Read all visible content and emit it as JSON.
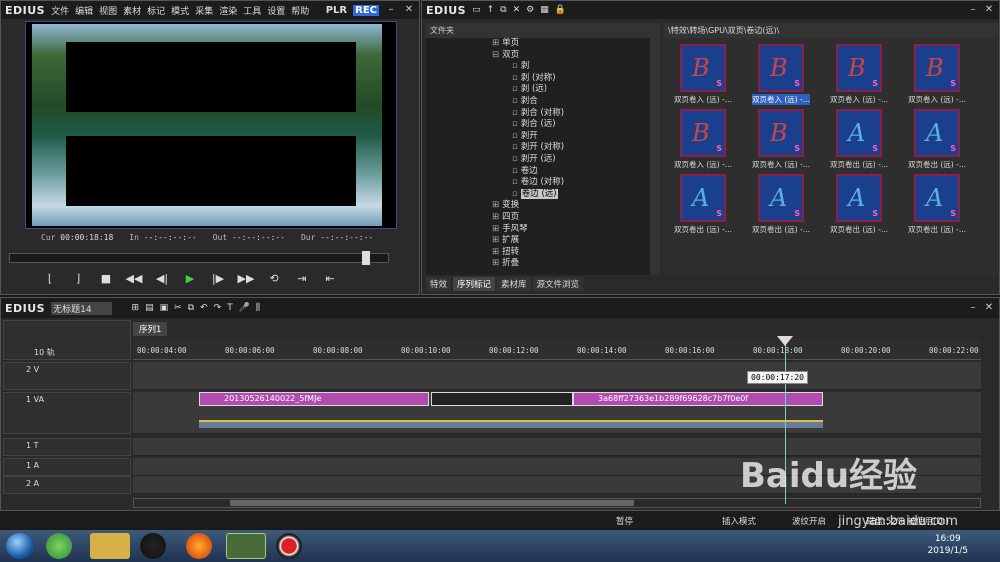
{
  "player": {
    "app": "EDIUS",
    "menus": [
      "文件",
      "编辑",
      "视图",
      "素材",
      "标记",
      "模式",
      "采集",
      "渲染",
      "工具",
      "设置",
      "帮助"
    ],
    "mode_plr": "PLR",
    "mode_rec": "REC",
    "timecodes": [
      {
        "label": "Cur",
        "value": "00:00:18:18"
      },
      {
        "label": "In",
        "value": "--:--:--:--"
      },
      {
        "label": "Out",
        "value": "--:--:--:--"
      },
      {
        "label": "Dur",
        "value": "--:--:--:--"
      }
    ],
    "scrub_position": 0.93
  },
  "bin": {
    "app": "EDIUS",
    "tree_header": "文件夹",
    "tree": [
      {
        "text": "单页",
        "depth": 1,
        "expand": "+"
      },
      {
        "text": "双页",
        "depth": 1,
        "expand": "-"
      },
      {
        "text": "剥",
        "depth": 2
      },
      {
        "text": "剥 (对称)",
        "depth": 2
      },
      {
        "text": "剥 (远)",
        "depth": 2
      },
      {
        "text": "剥合",
        "depth": 2
      },
      {
        "text": "剥合 (对称)",
        "depth": 2
      },
      {
        "text": "剥合 (远)",
        "depth": 2
      },
      {
        "text": "剥开",
        "depth": 2
      },
      {
        "text": "剥开 (对称)",
        "depth": 2
      },
      {
        "text": "剥开 (远)",
        "depth": 2
      },
      {
        "text": "卷边",
        "depth": 2
      },
      {
        "text": "卷边 (对称)",
        "depth": 2
      },
      {
        "text": "卷边 (远)",
        "depth": 2,
        "selected": true
      },
      {
        "text": "变换",
        "depth": 1,
        "expand": "+"
      },
      {
        "text": "四页",
        "depth": 1,
        "expand": "+"
      },
      {
        "text": "手风琴",
        "depth": 1,
        "expand": "+"
      },
      {
        "text": "扩展",
        "depth": 1,
        "expand": "+"
      },
      {
        "text": "扭转",
        "depth": 1,
        "expand": "+"
      },
      {
        "text": "折叠",
        "depth": 1,
        "expand": "+"
      }
    ],
    "path": "\\特效\\转场\\GPU\\双页\\卷边(远)\\",
    "thumbs": [
      {
        "letter": "B",
        "label": "双页卷入 (远) -..."
      },
      {
        "letter": "B",
        "label": "双页卷入 (远) -...",
        "selected": true
      },
      {
        "letter": "B",
        "label": "双页卷入 (远) -..."
      },
      {
        "letter": "B",
        "label": "双页卷入 (远) -..."
      },
      {
        "letter": "B",
        "label": "双页卷入 (远) -..."
      },
      {
        "letter": "B",
        "label": "双页卷入 (远) -..."
      },
      {
        "letter": "A",
        "label": "双页卷出 (远) -..."
      },
      {
        "letter": "A",
        "label": "双页卷出 (远) -..."
      },
      {
        "letter": "A",
        "label": "双页卷出 (远) -..."
      },
      {
        "letter": "A",
        "label": "双页卷出 (远) -..."
      },
      {
        "letter": "A",
        "label": "双页卷出 (远) -..."
      },
      {
        "letter": "A",
        "label": "双页卷出 (远) -..."
      }
    ],
    "tabs": [
      "特效",
      "序列标记",
      "素材库",
      "源文件浏览"
    ],
    "active_tab": 1
  },
  "timeline": {
    "app": "EDIUS",
    "project_name": "无标题14",
    "seq_tab": "序列1",
    "track_count": "10 轨",
    "ruler_labels": [
      "00:00:04:00",
      "00:00:06:00",
      "00:00:08:00",
      "00:00:10:00",
      "00:00:12:00",
      "00:00:14:00",
      "00:00:16:00",
      "00:00:18:00",
      "00:00:20:00",
      "00:00:22:00"
    ],
    "tracks": [
      "2 V",
      "1 VA",
      "1 T",
      "1 A",
      "2 A"
    ],
    "clip1": "20130526140022_5fMJe",
    "clip2": "3a68ff27363e1b289f69628c7b7f0e0f",
    "tooltip": "00:00:17:20"
  },
  "status": {
    "stopped": "暂停",
    "insert_mode": "插入模式",
    "wave": "波纹开启",
    "disk": "磁盘:52% 被使用(D:)"
  },
  "taskbar": {
    "time": "16:09",
    "date": "2019/1/5"
  },
  "watermark": {
    "brand": "Baidu经验",
    "url": "jingyan.baidu.com"
  }
}
